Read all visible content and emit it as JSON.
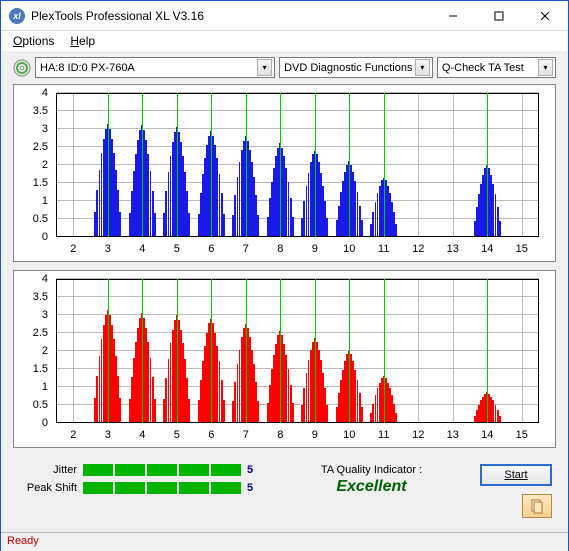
{
  "window": {
    "title": "PlexTools Professional XL V3.16"
  },
  "menu": {
    "options": "Options",
    "help": "Help"
  },
  "toolbar": {
    "device": "HA:8 ID:0   PX-760A",
    "diag": "DVD Diagnostic Functions",
    "qcheck": "Q-Check TA Test"
  },
  "chart_data": [
    {
      "type": "bar",
      "color": "#1a1ae8",
      "ylim": [
        0,
        4
      ],
      "yticks": [
        0,
        0.5,
        1,
        1.5,
        2,
        2.5,
        3,
        3.5,
        4
      ],
      "xlim": [
        1.5,
        15.5
      ],
      "xticks": [
        2,
        3,
        4,
        5,
        6,
        7,
        8,
        9,
        10,
        11,
        12,
        13,
        14,
        15
      ],
      "green_lines": [
        3,
        4,
        5,
        6,
        7,
        8,
        9,
        10,
        11,
        14
      ],
      "peaks": [
        {
          "center": 3.0,
          "height": 3.15
        },
        {
          "center": 4.0,
          "height": 3.1
        },
        {
          "center": 5.0,
          "height": 3.05
        },
        {
          "center": 6.0,
          "height": 2.95
        },
        {
          "center": 7.0,
          "height": 2.8
        },
        {
          "center": 8.0,
          "height": 2.6
        },
        {
          "center": 9.0,
          "height": 2.4
        },
        {
          "center": 10.0,
          "height": 2.1
        },
        {
          "center": 11.0,
          "height": 1.65
        },
        {
          "center": 14.0,
          "height": 2.0
        }
      ]
    },
    {
      "type": "bar",
      "color": "#ff0000",
      "ylim": [
        0,
        4
      ],
      "yticks": [
        0,
        0.5,
        1,
        1.5,
        2,
        2.5,
        3,
        3.5,
        4
      ],
      "xlim": [
        1.5,
        15.5
      ],
      "xticks": [
        2,
        3,
        4,
        5,
        6,
        7,
        8,
        9,
        10,
        11,
        12,
        13,
        14,
        15
      ],
      "green_lines": [
        3,
        4,
        5,
        6,
        7,
        8,
        9,
        10,
        11,
        14
      ],
      "peaks": [
        {
          "center": 3.0,
          "height": 3.15
        },
        {
          "center": 4.0,
          "height": 3.05
        },
        {
          "center": 5.0,
          "height": 3.0
        },
        {
          "center": 6.0,
          "height": 2.9
        },
        {
          "center": 7.0,
          "height": 2.75
        },
        {
          "center": 8.0,
          "height": 2.55
        },
        {
          "center": 9.0,
          "height": 2.35
        },
        {
          "center": 10.0,
          "height": 2.0
        },
        {
          "center": 11.0,
          "height": 1.3
        },
        {
          "center": 14.0,
          "height": 0.85
        }
      ]
    }
  ],
  "quality": {
    "jitter_label": "Jitter",
    "jitter_value": "5",
    "jitter_segments": 5,
    "peakshift_label": "Peak Shift",
    "peakshift_value": "5",
    "peakshift_segments": 5,
    "indicator_label": "TA Quality Indicator :",
    "indicator_value": "Excellent",
    "start_label": "Start"
  },
  "status": {
    "text": "Ready"
  }
}
